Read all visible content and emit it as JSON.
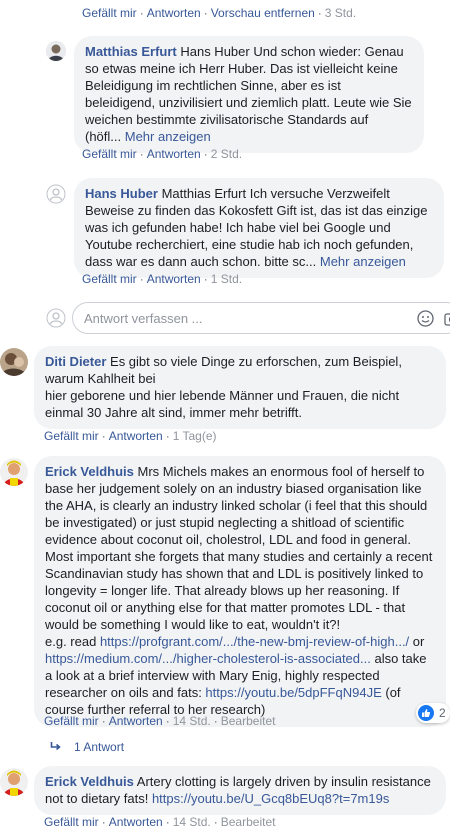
{
  "labels": {
    "like": "Gefällt mir",
    "reply": "Antworten",
    "sep": "·",
    "remove_preview": "Vorschau entfernen",
    "show_more": "Mehr anzeigen",
    "edited": "Bearbeitet",
    "reply_placeholder": "Antwort verfassen ..."
  },
  "top_actions": {
    "time": "3 Std."
  },
  "comments": [
    {
      "author": "Matthias Erfurt",
      "text": " Hans Huber Und schon wieder: Genau so etwas meine ich Herr Huber. Das ist vielleicht keine Beleidigung im rechtlichen Sinne, aber es ist beleidigend, unzivilisiert und ziemlich platt. Leute wie Sie weichen bestimmte zivilisatorische Standards auf",
      "text_tail": "(höfl...",
      "time": "2 Std."
    },
    {
      "author": "Hans Huber",
      "text": " Matthias Erfurt Ich versuche Verzweifelt Beweise zu finden das Kokosfett Gift ist, das ist das einzige was ich gefunden habe! Ich habe viel bei Google und Youtube recherchiert, eine studie hab ich noch gefunden, dass war es dann auch schon. bitte sc...",
      "time": "1 Std."
    },
    {
      "author": "Diti Dieter",
      "text_1": " Es gibt so viele Dinge zu erforschen, zum Beispiel, warum Kahlheit bei",
      "text_2": "hier geborene und hier lebende Männer und Frauen, die nicht einmal 30 Jahre alt sind, immer mehr betrifft.",
      "time": "1 Tag(e)"
    },
    {
      "author": "Erick Veldhuis",
      "text": " Mrs Michels makes an enormous fool of herself to base her judgement solely on an industry biased organisation like the AHA, is clearly an industry linked scholar (i feel that this should be investigated) or just stupid neglecting a shitload of scientific evidence about coconut oil, cholestrol, LDL and food in general. Most important she forgets that many studies and certainly a recent Scandinavian study has shown that and LDL is positively linked to longevity = longer life. That already blows up her reasoning. If coconut oil or anything else for that matter promotes LDL - that would be something I would like to eat, wouldn't it?!",
      "text_eg": "e.g. read ",
      "link_1": "https://profgrant.com/.../the-new-bmj-review-of-high.../",
      "or": " or ",
      "link_2": "https://medium.com/.../higher-cholesterol-is-associated...",
      "text_after": " also take a look at a brief interview with Mary Enig, highly respected researcher on oils and fats: ",
      "link_3": "https://youtu.be/5dpFFqN94JE",
      "text_end": " (of course further referral to her research)",
      "time": "14 Std.",
      "reaction_count": "2",
      "replies": "1 Antwort"
    },
    {
      "author": "Erick Veldhuis",
      "text": " Artery clotting is largely driven by insulin resistance not to dietary fats! ",
      "link": "https://youtu.be/U_Gcq8bEUq8?t=7m19s",
      "time": "14 Std."
    }
  ],
  "colors": {
    "link": "#385898",
    "bubble": "#f2f3f5",
    "like_badge": "#1877f2",
    "muted": "#606770"
  },
  "icons": [
    "avatar-photo",
    "default-avatar-icon",
    "emoji-icon",
    "camera-icon",
    "like-icon",
    "reply-arrow-icon"
  ]
}
